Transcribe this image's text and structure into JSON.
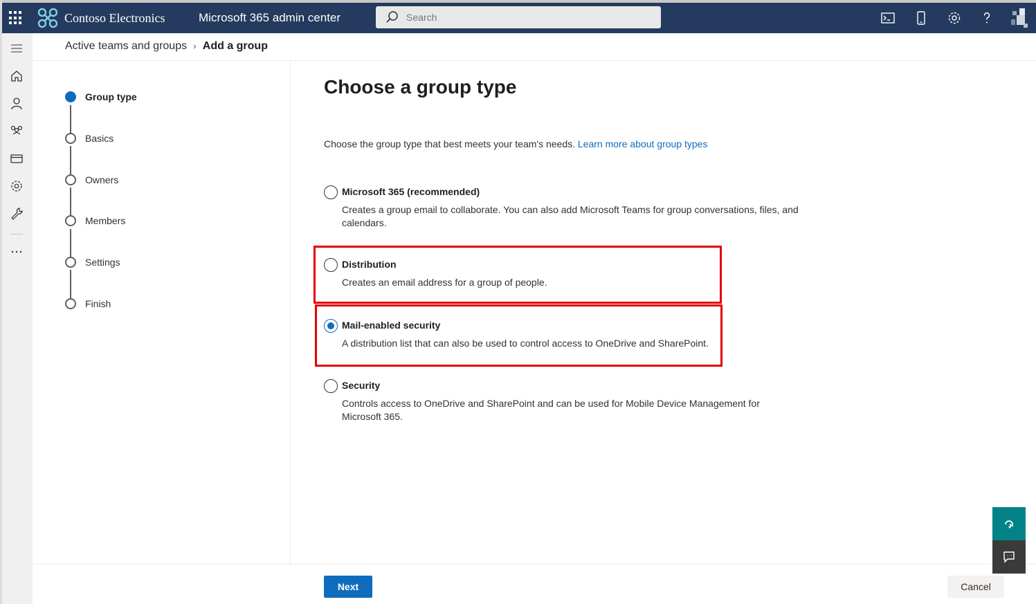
{
  "header": {
    "org_name": "Contoso Electronics",
    "app_name": "Microsoft 365 admin center",
    "search_placeholder": "Search"
  },
  "breadcrumb": {
    "parent": "Active teams and groups",
    "current": "Add a group"
  },
  "steps": [
    {
      "label": "Group type",
      "active": true
    },
    {
      "label": "Basics",
      "active": false
    },
    {
      "label": "Owners",
      "active": false
    },
    {
      "label": "Members",
      "active": false
    },
    {
      "label": "Settings",
      "active": false
    },
    {
      "label": "Finish",
      "active": false
    }
  ],
  "main": {
    "title": "Choose a group type",
    "description": "Choose the group type that best meets your team's needs.",
    "learn_more": "Learn more about group types",
    "options": [
      {
        "label": "Microsoft 365 (recommended)",
        "description": "Creates a group email to collaborate. You can also add Microsoft Teams for group conversations, files, and calendars.",
        "selected": false
      },
      {
        "label": "Distribution",
        "description": "Creates an email address for a group of people.",
        "selected": false
      },
      {
        "label": "Mail-enabled security",
        "description": "A distribution list that can also be used to control access to OneDrive and SharePoint.",
        "selected": true
      },
      {
        "label": "Security",
        "description": "Controls access to OneDrive and SharePoint and can be used for Mobile Device Management for Microsoft 365.",
        "selected": false
      }
    ]
  },
  "footer": {
    "next_label": "Next",
    "cancel_label": "Cancel"
  },
  "colors": {
    "header_bg": "#243a5e",
    "accent": "#0f6cbd",
    "highlight": "#e00000",
    "help_fab": "#038387"
  },
  "icons": {
    "header": [
      "app-launcher-icon",
      "contoso-logo-icon",
      "search-icon",
      "terminal-icon",
      "mobile-icon",
      "settings-icon",
      "help-icon"
    ],
    "rail": [
      "hamburger-icon",
      "home-icon",
      "user-icon",
      "groups-icon",
      "billing-icon",
      "settings-icon",
      "setup-icon",
      "more-icon"
    ]
  }
}
